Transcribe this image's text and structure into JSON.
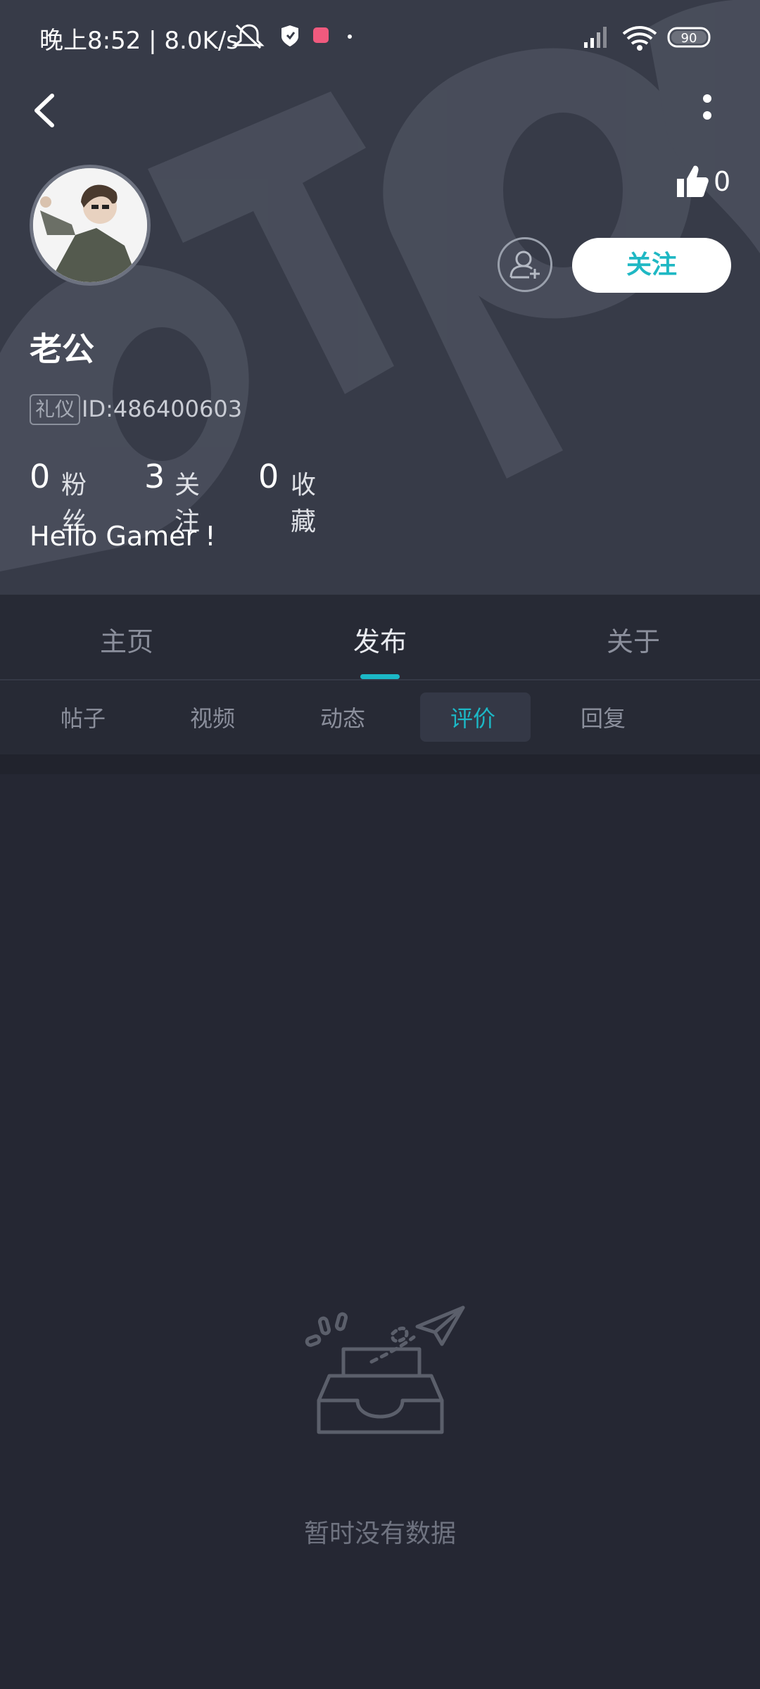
{
  "status_bar": {
    "time": "晚上8:52 | 8.0K/s",
    "battery": "90"
  },
  "profile": {
    "likes": "0",
    "follow_label": "关注",
    "username": "老公",
    "title_badge": "礼仪",
    "id_text": "ID:486400603",
    "stats": [
      {
        "value": "0",
        "label": "粉丝"
      },
      {
        "value": "3",
        "label": "关注"
      },
      {
        "value": "0",
        "label": "收藏"
      }
    ],
    "bio": "Hello Gamer !"
  },
  "tabs": [
    {
      "label": "主页"
    },
    {
      "label": "发布",
      "active": true
    },
    {
      "label": "关于"
    }
  ],
  "sub_tabs": [
    {
      "label": "帖子"
    },
    {
      "label": "视频"
    },
    {
      "label": "动态"
    },
    {
      "label": "评价",
      "active": true
    },
    {
      "label": "回复"
    }
  ],
  "empty_state": {
    "text": "暂时没有数据"
  },
  "colors": {
    "accent": "#1cb8c6",
    "header_bg": "#373b48",
    "page_bg": "#252733"
  }
}
